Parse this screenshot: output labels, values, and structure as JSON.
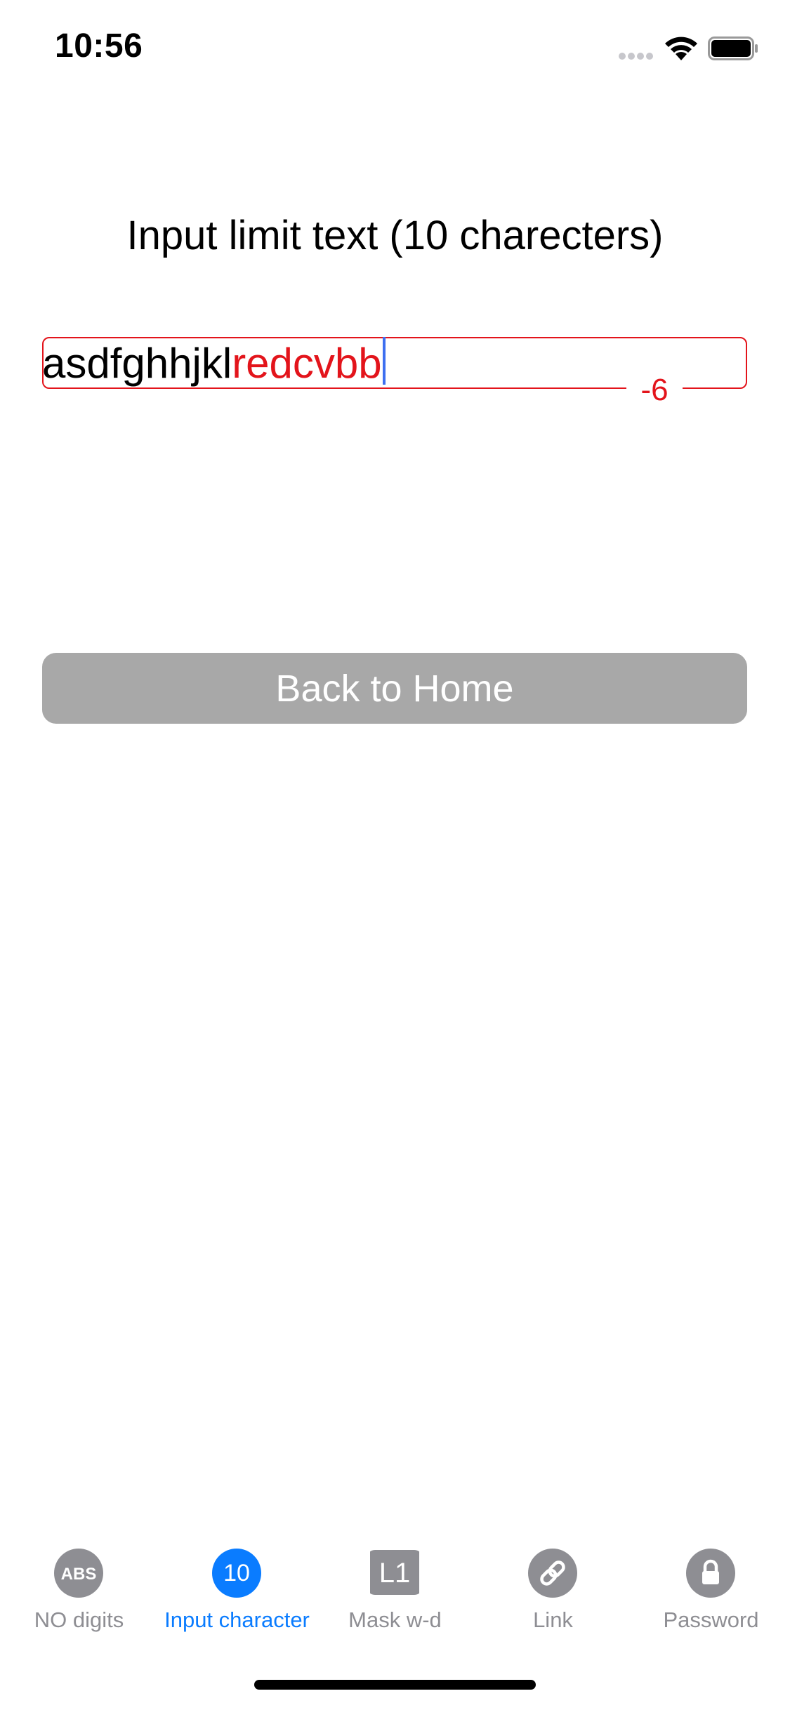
{
  "status_bar": {
    "time": "10:56",
    "icons": [
      "cellular-dots-icon",
      "wifi-icon",
      "battery-icon"
    ]
  },
  "title": "Input limit text (10 charecters)",
  "input": {
    "text_within_limit": "asdfghhjkl",
    "text_over_limit": "redcvbb",
    "counter": "-6",
    "limit": 10
  },
  "button": {
    "label": "Back to Home"
  },
  "tab_bar": {
    "selected_index": 1,
    "tabs": [
      {
        "label": "NO digits",
        "icon": "abs-icon",
        "icon_text": "ABS"
      },
      {
        "label": "Input character",
        "icon": "number-ten-icon",
        "icon_text": "10"
      },
      {
        "label": "Mask w-d",
        "icon": "l1-icon",
        "icon_text": "L1"
      },
      {
        "label": "Link",
        "icon": "link-icon",
        "icon_text": ""
      },
      {
        "label": "Password",
        "icon": "lock-icon",
        "icon_text": ""
      }
    ]
  },
  "colors": {
    "error_red": "#e3141b",
    "active_blue": "#0a7cff",
    "inactive_gray": "#8e8e93",
    "button_gray": "#a8a8a8",
    "caret_blue": "#3d6ff0"
  }
}
